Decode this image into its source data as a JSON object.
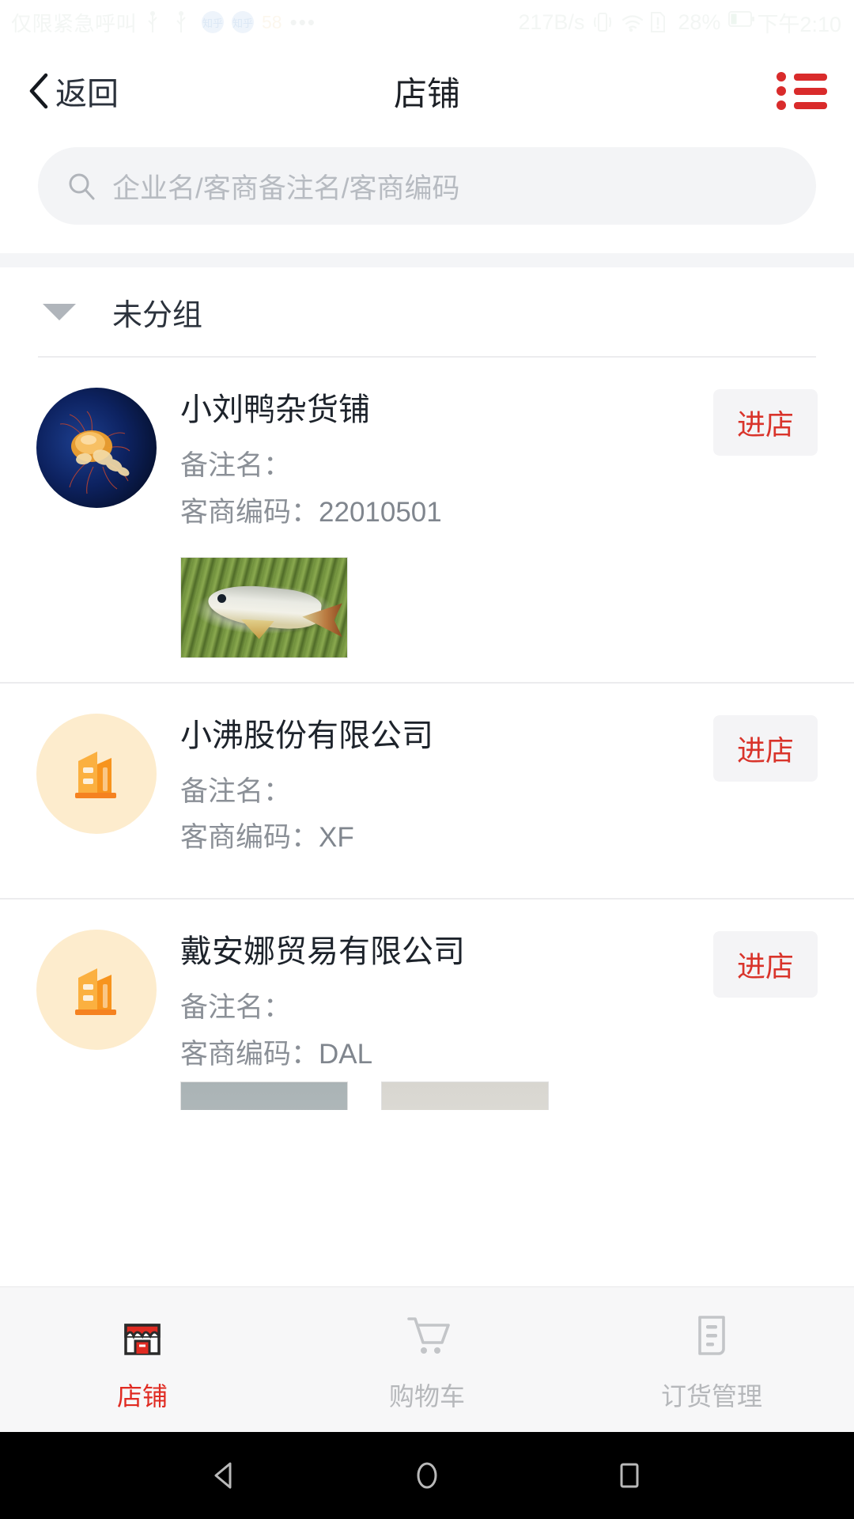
{
  "status_bar": {
    "carrier_text": "仅限紧急呼叫",
    "app_badge_1": "知乎",
    "app_badge_2": "知乎",
    "notif_count": "58",
    "overflow": "•••",
    "network_speed": "217B/s",
    "battery_percent": "28%",
    "time": "下午2:10",
    "icons": [
      "usb-icon",
      "usb-icon",
      "app-badge-icon",
      "app-badge-icon",
      "more-icon",
      "vibrate-icon",
      "wifi-icon",
      "sim-alert-icon",
      "battery-icon"
    ]
  },
  "header": {
    "back_label": "返回",
    "title": "店铺",
    "menu_icon": "list-menu-icon"
  },
  "search": {
    "placeholder": "企业名/客商备注名/客商编码",
    "icon": "search-icon"
  },
  "group": {
    "title": "未分组",
    "caret_icon": "chevron-down-icon",
    "expanded": true
  },
  "labels": {
    "remark_name": "备注名：",
    "customer_code": "客商编码：",
    "enter_store": "进店"
  },
  "stores": [
    {
      "name": "小刘鸭杂货铺",
      "remark_label": "备注名：",
      "remark_value": "",
      "code_label": "客商编码：",
      "code_value": "22010501",
      "enter_label": "进店",
      "avatar_type": "photo-jellyfish",
      "products": [
        "fish-photo"
      ]
    },
    {
      "name": "小沸股份有限公司",
      "remark_label": "备注名：",
      "remark_value": "",
      "code_label": "客商编码：",
      "code_value": "XF",
      "enter_label": "进店",
      "avatar_type": "building-icon",
      "products": []
    },
    {
      "name": "戴安娜贸易有限公司",
      "remark_label": "备注名：",
      "remark_value": "",
      "code_label": "客商编码：",
      "code_value": "DAL",
      "enter_label": "进店",
      "avatar_type": "building-icon",
      "products": [
        "thumb-cut-a",
        "thumb-cut-b"
      ]
    }
  ],
  "tabbar": {
    "items": [
      {
        "label": "店铺",
        "icon": "shop-icon",
        "active": true
      },
      {
        "label": "购物车",
        "icon": "cart-icon",
        "active": false
      },
      {
        "label": "订货管理",
        "icon": "order-list-icon",
        "active": false
      }
    ]
  },
  "android_nav": {
    "back": "nav-back-icon",
    "home": "nav-home-icon",
    "recents": "nav-recents-icon"
  },
  "colors": {
    "accent_red": "#d9342b",
    "menu_red": "#d92b2b",
    "tab_active": "#e02b22",
    "text_primary": "#1d232b",
    "text_secondary": "#8b9097",
    "search_bg": "#f3f4f6",
    "tabbar_bg": "#f7f7f8",
    "avatar_bg": "#fdeccd",
    "building_orange": "#f79a2a"
  }
}
